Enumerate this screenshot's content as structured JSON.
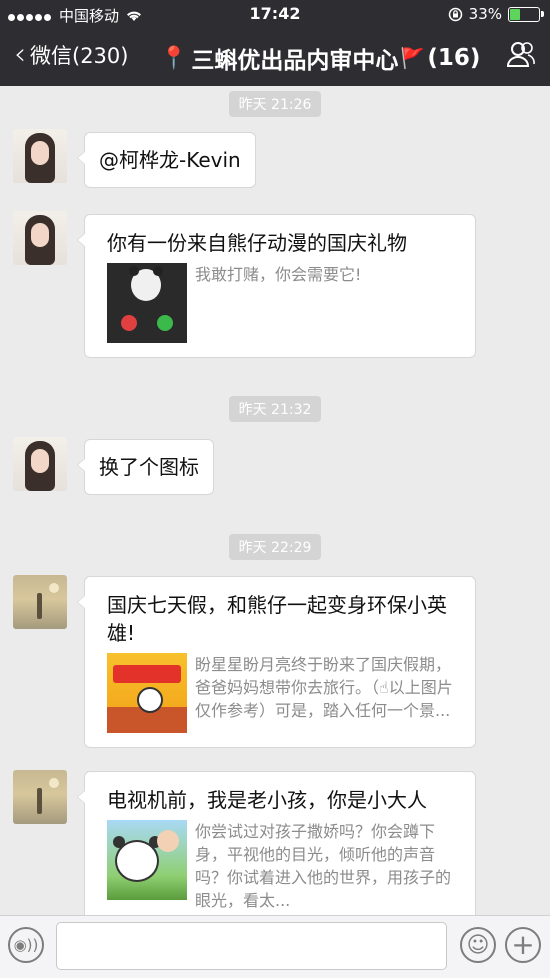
{
  "status_bar": {
    "carrier": "中国移动",
    "time": "17:42",
    "battery_percent": "33%",
    "battery_level": 0.33
  },
  "nav": {
    "back_label": "微信(230)",
    "chat_title": "三蝌优出品内审中心",
    "member_count": "(16)"
  },
  "messages": [
    {
      "type": "timestamp",
      "text": "昨天 21:26"
    },
    {
      "type": "text",
      "sender_avatar": "girl-avatar",
      "text": "@柯桦龙-Kevin"
    },
    {
      "type": "link",
      "sender_avatar": "girl-avatar",
      "title": "你有一份来自熊仔动漫的国庆礼物",
      "desc": "我敢打赌，你会需要它!",
      "thumb": "panda-call"
    },
    {
      "type": "timestamp",
      "text": "昨天 21:32"
    },
    {
      "type": "text",
      "sender_avatar": "girl-avatar",
      "text": "换了个图标"
    },
    {
      "type": "timestamp",
      "text": "昨天 22:29"
    },
    {
      "type": "link",
      "sender_avatar": "sea-avatar",
      "title": "国庆七天假，和熊仔一起变身环保小英雄!",
      "desc": "盼星星盼月亮终于盼来了国庆假期，爸爸妈妈想带你去旅行。（☝以上图片仅作参考）可是，踏入任何一个景...",
      "thumb": "game-banner"
    },
    {
      "type": "link",
      "sender_avatar": "sea-avatar",
      "title": "电视机前，我是老小孩，你是小大人",
      "desc": "你尝试过对孩子撒娇吗？你会蹲下身，平视他的目光，倾听他的声音吗？你试着进入他的世界，用孩子的眼光，看太...",
      "thumb": "panda-kid"
    }
  ],
  "input_bar": {
    "voice_icon": "voice-icon",
    "emoji_icon": "emoji-icon",
    "plus_icon": "plus-icon"
  },
  "colors": {
    "nav_bg": "#2e2d31",
    "chat_bg": "#ebebeb",
    "timestamp_bg": "#d4d4d4",
    "pin_flag": "#e84a4a"
  }
}
